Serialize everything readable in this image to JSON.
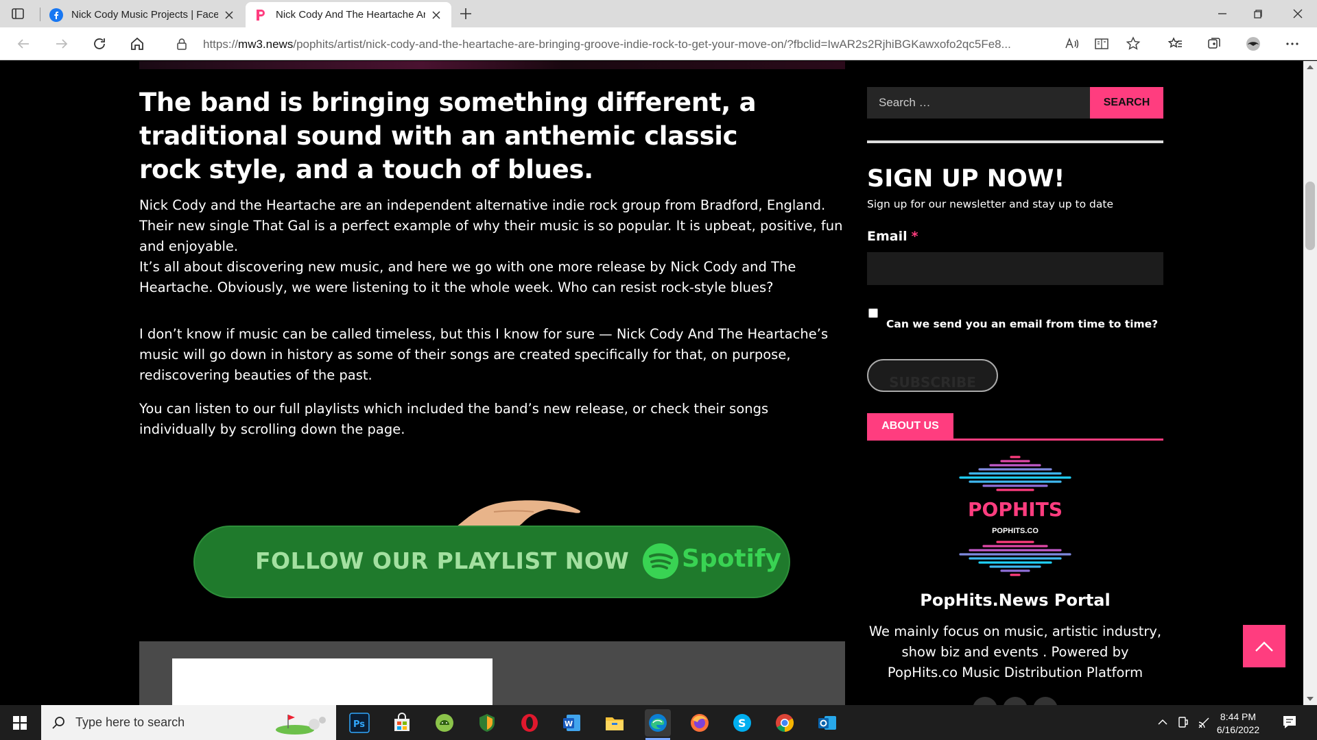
{
  "browser": {
    "tabs": [
      {
        "title": "Nick Cody Music Projects | Faceb",
        "favicon": "facebook-icon",
        "active": false
      },
      {
        "title": "Nick Cody And The Heartache Ar",
        "favicon": "pophits-p-icon",
        "active": true
      }
    ],
    "url_prefix": "https://",
    "url_host": "mw3.news",
    "url_rest": "/pophits/artist/nick-cody-and-the-heartache-are-bringing-groove-indie-rock-to-get-your-move-on/?fbclid=IwAR2s2RjhiBGKawxofo2qc5Fe8..."
  },
  "article": {
    "heading": "The band is bringing something different, a traditional sound with an anthemic classic rock style, and a touch of blues.",
    "paragraphs": [
      "Nick Cody and the Heartache are an independent alternative indie rock group from Bradford, England. Their new single That Gal is a perfect example of why their music is so popular. It is upbeat, positive, fun and enjoyable.",
      "It’s all about discovering new music, and here we go with one more release by Nick Cody and The Heartache. Obviously, we were listening to it the whole week. Who can resist rock-style blues?",
      "I don’t know if music can be called timeless, but this I know for sure — Nick Cody And The Heartache’s music will go down in history as some of their songs are created specifically for that, on purpose, rediscovering beauties of the past.",
      "You can listen to our full playlists which included the band’s new release, or check their songs individually by scrolling down the page."
    ],
    "playlist_banner": {
      "label": "FOLLOW OUR PLAYLIST NOW",
      "brand": "Spotify"
    }
  },
  "sidebar": {
    "search_placeholder": "Search …",
    "search_button": "SEARCH",
    "signup_title": "SIGN UP NOW!",
    "signup_subtitle": "Sign up for our newsletter and stay up to date",
    "email_label": "Email",
    "email_required_mark": "*",
    "consent_label": "Can we send you an email from time to time?",
    "subscribe_button": "SUBSCRIBE",
    "about_tab": "ABOUT US",
    "logo_name": "POPHITS",
    "logo_domain": "POPHITS.CO",
    "portal_name": "PopHits.News Portal",
    "portal_description": "We mainly focus on music, artistic industry, show biz and events . Powered by PopHits.co Music Distribution Platform"
  },
  "taskbar": {
    "search_placeholder": "Type here to search",
    "time": "8:44 PM",
    "date": "6/16/2022",
    "apps": [
      "photoshop-icon",
      "store-icon",
      "android-icon",
      "shield-app-icon",
      "opera-icon",
      "word-icon",
      "file-explorer-icon",
      "edge-icon",
      "firefox-icon",
      "skype-icon",
      "chrome-icon",
      "outlook-icon"
    ]
  },
  "colors": {
    "accent": "#ff3d7f",
    "page_bg": "#000000",
    "spotify_green": "#1f7a2c"
  }
}
